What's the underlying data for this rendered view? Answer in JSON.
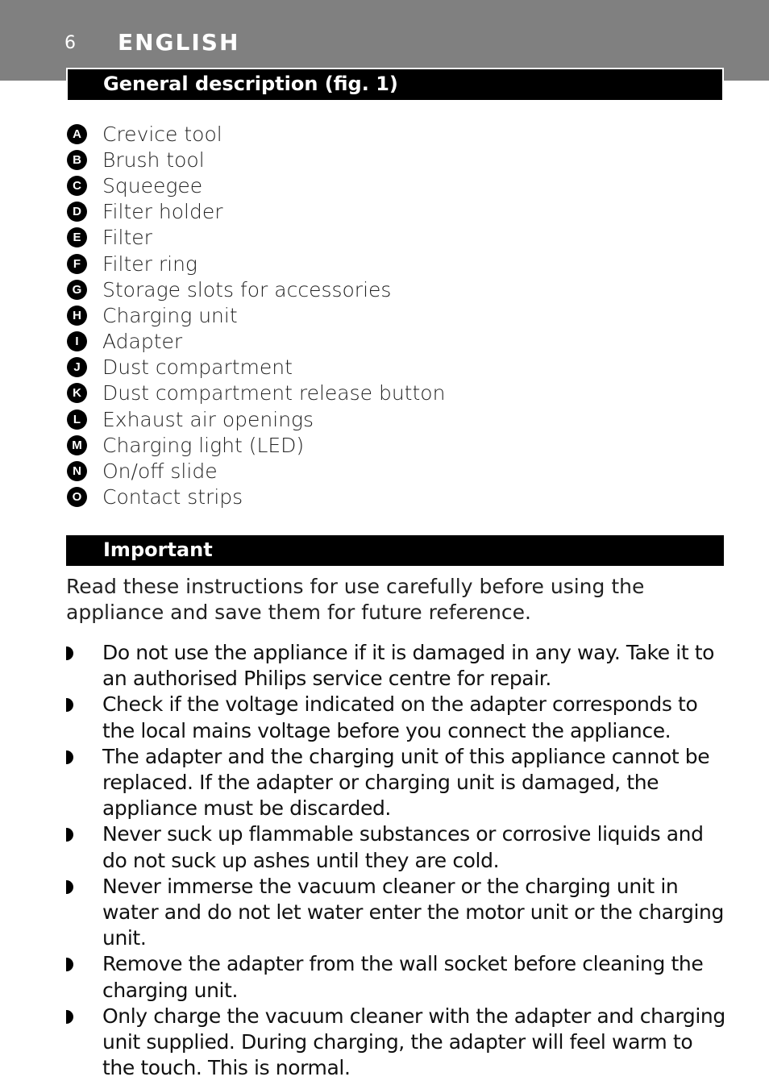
{
  "header": {
    "page_number": "6",
    "language": "ENGLISH"
  },
  "sections": {
    "general": {
      "title": "General description (fig. 1)",
      "parts": [
        {
          "letter": "A",
          "label": "Crevice tool"
        },
        {
          "letter": "B",
          "label": "Brush tool"
        },
        {
          "letter": "C",
          "label": "Squeegee"
        },
        {
          "letter": "D",
          "label": "Filter holder"
        },
        {
          "letter": "E",
          "label": "Filter"
        },
        {
          "letter": "F",
          "label": "Filter ring"
        },
        {
          "letter": "G",
          "label": "Storage slots for accessories"
        },
        {
          "letter": "H",
          "label": "Charging unit"
        },
        {
          "letter": "I",
          "label": "Adapter"
        },
        {
          "letter": "J",
          "label": "Dust compartment"
        },
        {
          "letter": "K",
          "label": "Dust compartment release button"
        },
        {
          "letter": "L",
          "label": "Exhaust air openings"
        },
        {
          "letter": "M",
          "label": "Charging light (LED)"
        },
        {
          "letter": "N",
          "label": "On/off slide"
        },
        {
          "letter": "O",
          "label": "Contact strips"
        }
      ]
    },
    "important": {
      "title": "Important",
      "intro": "Read these instructions for use carefully before using the appliance and save them for future reference.",
      "bullets": [
        "Do not use the appliance if it is damaged in any way. Take it to an authorised Philips service centre for repair.",
        "Check if the voltage indicated on the adapter corresponds to the local mains voltage before you connect the appliance.",
        "The adapter and the charging unit of this appliance cannot be replaced. If the adapter or charging unit is damaged, the appliance must be discarded.",
        "Never suck up flammable substances or corrosive liquids and do not suck up ashes until they are cold.",
        "Never immerse the vacuum cleaner or the charging unit in water and do not let water enter the motor unit or the charging unit.",
        "Remove the adapter from the wall socket before cleaning the charging unit.",
        "Only charge the vacuum cleaner with the adapter and charging unit supplied. During charging, the adapter will feel warm to the touch. This is normal."
      ]
    }
  },
  "icons": {
    "part_badge": "circled-letter-icon",
    "bullet": "half-circle-bullet-icon"
  },
  "colors": {
    "header_band": "#808080",
    "section_bar": "#000000",
    "text": "#1a1a1a"
  }
}
